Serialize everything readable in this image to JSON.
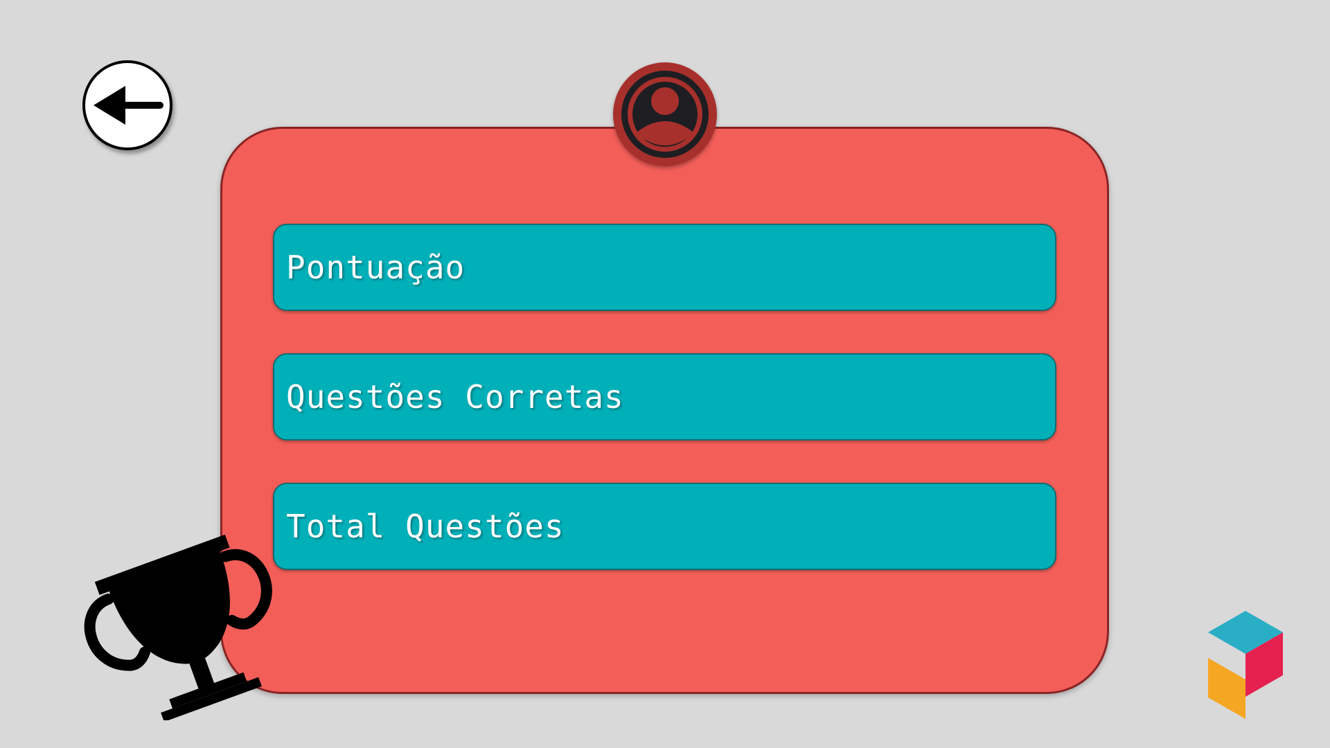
{
  "back_button": {
    "icon": "arrow-left-icon"
  },
  "profile": {
    "icon": "user-avatar-icon"
  },
  "stats": [
    {
      "label": "Pontuação"
    },
    {
      "label": "Questões Corretas"
    },
    {
      "label": "Total Questões"
    }
  ],
  "decorations": {
    "trophy_icon": "trophy-icon",
    "logo_icon": "cube-logo-icon"
  },
  "colors": {
    "background": "#d9d9d9",
    "card": "#f35e58",
    "card_border": "#8a2424",
    "field": "#00b0b9",
    "avatar_ring": "#a8302c",
    "logo_teal": "#2aaec6",
    "logo_red": "#e5224f",
    "logo_orange": "#f5a623"
  }
}
